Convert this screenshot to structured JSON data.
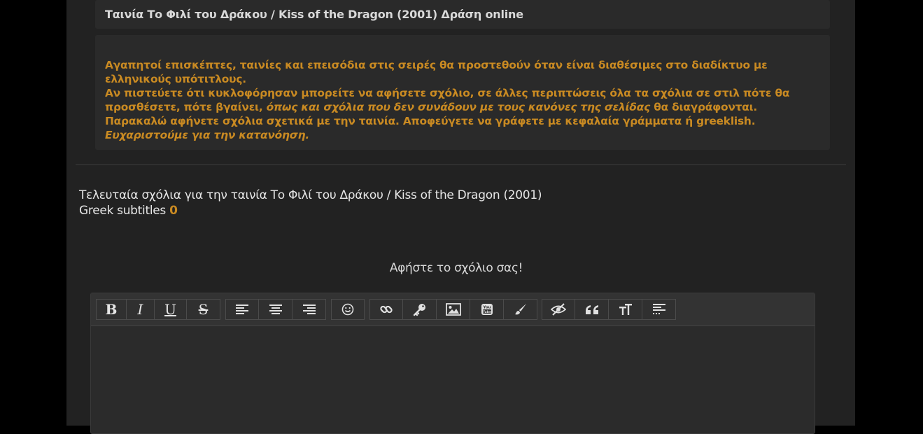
{
  "movie_title": "Ταινία Το Φιλί του Δράκου / Kiss of the Dragon (2001) Δράση online",
  "notice": {
    "line1": "Αγαπητοί επισκέπτες, ταινίες και επεισόδια στις σειρές θα προστεθούν όταν είναι διαθέσιμες στο διαδίκτυο με ελληνικούς υπότιτλους.",
    "line2_a": "Αν πιστεύετε ότι κυκλοφόρησαν μπορείτε να αφήσετε σχόλιο, σε άλλες περιπτώσεις όλα τα σχόλια σε στιλ πότε θα προσθέσετε, πότε βγαίνει, ",
    "line2_em": "όπως και σχόλια που δεν συνάδουν με τους κανόνες της σελίδας",
    "line2_b": " θα διαγράφονται.",
    "line3": "Παρακαλώ αφήνετε σχόλια σχετικά με την ταινία. Αποφεύγετε να γράφετε με κεφαλαία γράμματα ή greeklish.",
    "line4": "Ευχαριστούμε για την κατανόηση."
  },
  "comments": {
    "latest_label": "Τελευταία σχόλια για την ταινία Το Φιλί του Δράκου / Kiss of the Dragon (2001)",
    "subtitles_label": "Greek subtitles",
    "subtitles_count": "0",
    "leave_prompt": "Αφήστε το σχόλιο σας!"
  },
  "toolbar": {
    "bold": "B",
    "italic": "I",
    "underline": "U",
    "strike": "S",
    "icons": [
      "bold-icon",
      "italic-icon",
      "underline-icon",
      "strikethrough-icon",
      "align-left-icon",
      "align-center-icon",
      "align-right-icon",
      "smiley-icon",
      "link-icon",
      "key-icon",
      "image-icon",
      "youtube-icon",
      "brush-icon",
      "hide-icon",
      "quote-icon",
      "font-size-icon",
      "align-justify-icon"
    ]
  },
  "colors": {
    "accent": "#c98a22",
    "background": "#222222",
    "outer": "#000000"
  }
}
